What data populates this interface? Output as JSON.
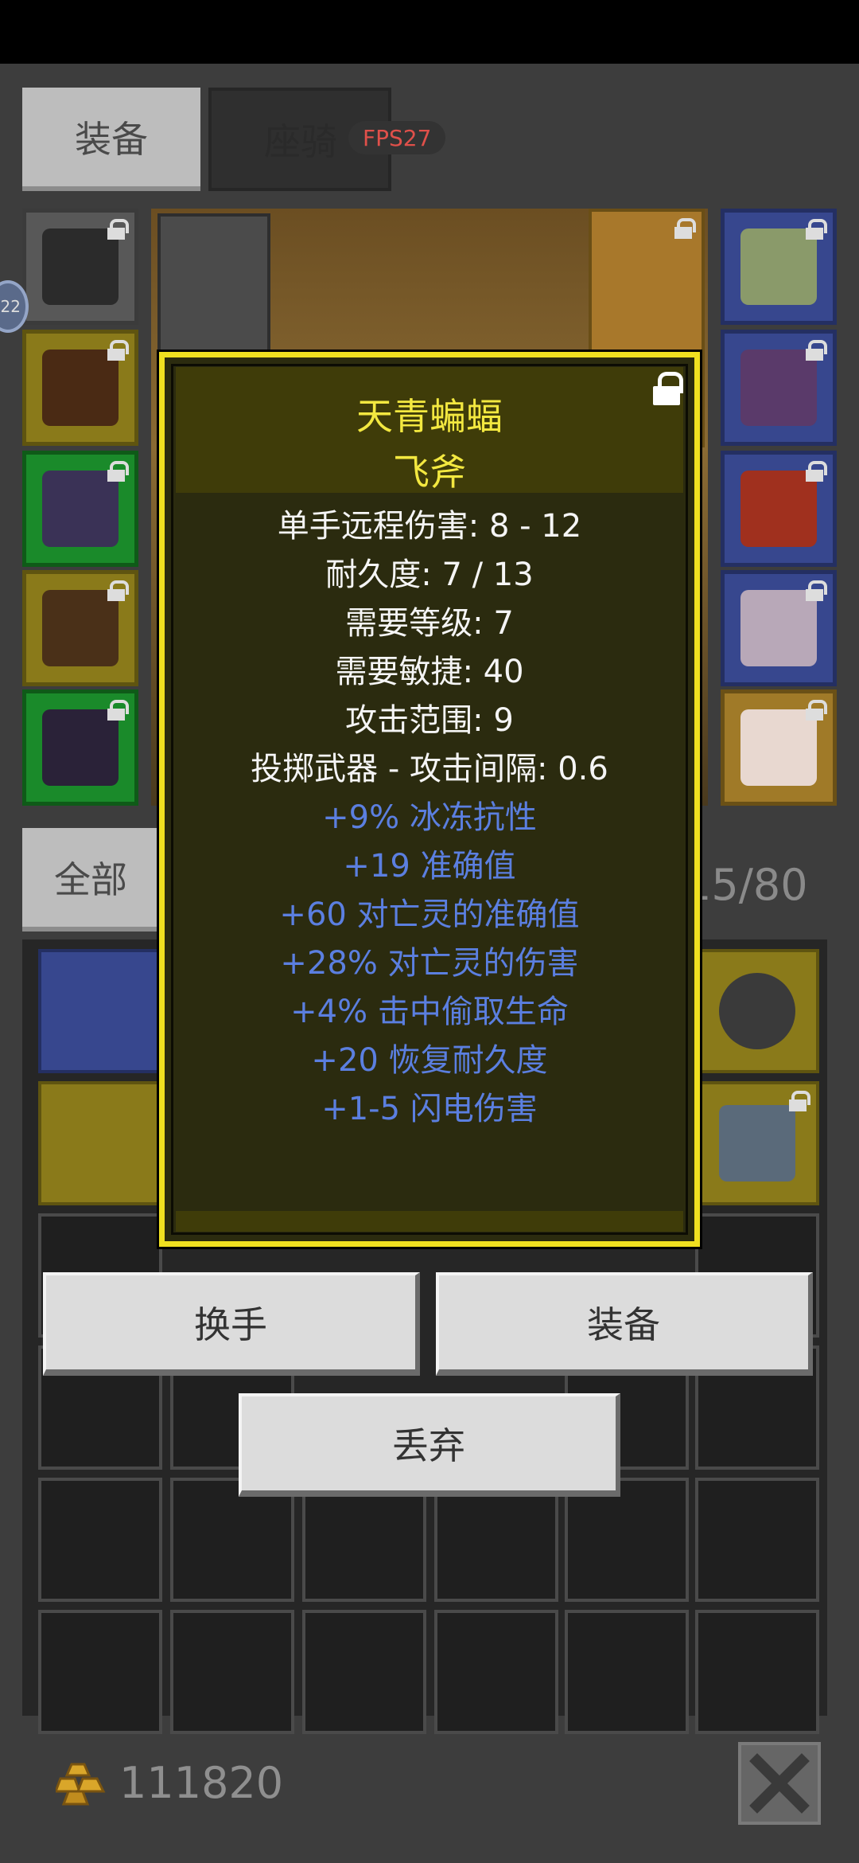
{
  "tabs": {
    "equipment": "装备",
    "mount": "座骑",
    "fps": "FPS27"
  },
  "side_badge": "22",
  "filter": {
    "all": "全部",
    "capacity": "15/80"
  },
  "popup": {
    "name": "天青蝙蝠",
    "type": "飞斧",
    "stats": [
      "单手远程伤害: 8 - 12",
      "耐久度: 7 / 13",
      "需要等级: 7",
      "需要敏捷: 40",
      "攻击范围: 9",
      "投掷武器 - 攻击间隔: 0.6"
    ],
    "modifiers": [
      "+9% 冰冻抗性",
      "+19 准确值",
      "+60 对亡灵的准确值",
      "+28% 对亡灵的伤害",
      "+4% 击中偷取生命",
      "+20 恢复耐久度",
      "+1-5 闪电伤害"
    ]
  },
  "actions": {
    "swap_hand": "换手",
    "equip": "装备",
    "drop": "丢弃"
  },
  "gold": "111820",
  "colors": {
    "popup_border": "#f0e020",
    "title": "#f3e840",
    "modifier": "#5b7fe0"
  }
}
